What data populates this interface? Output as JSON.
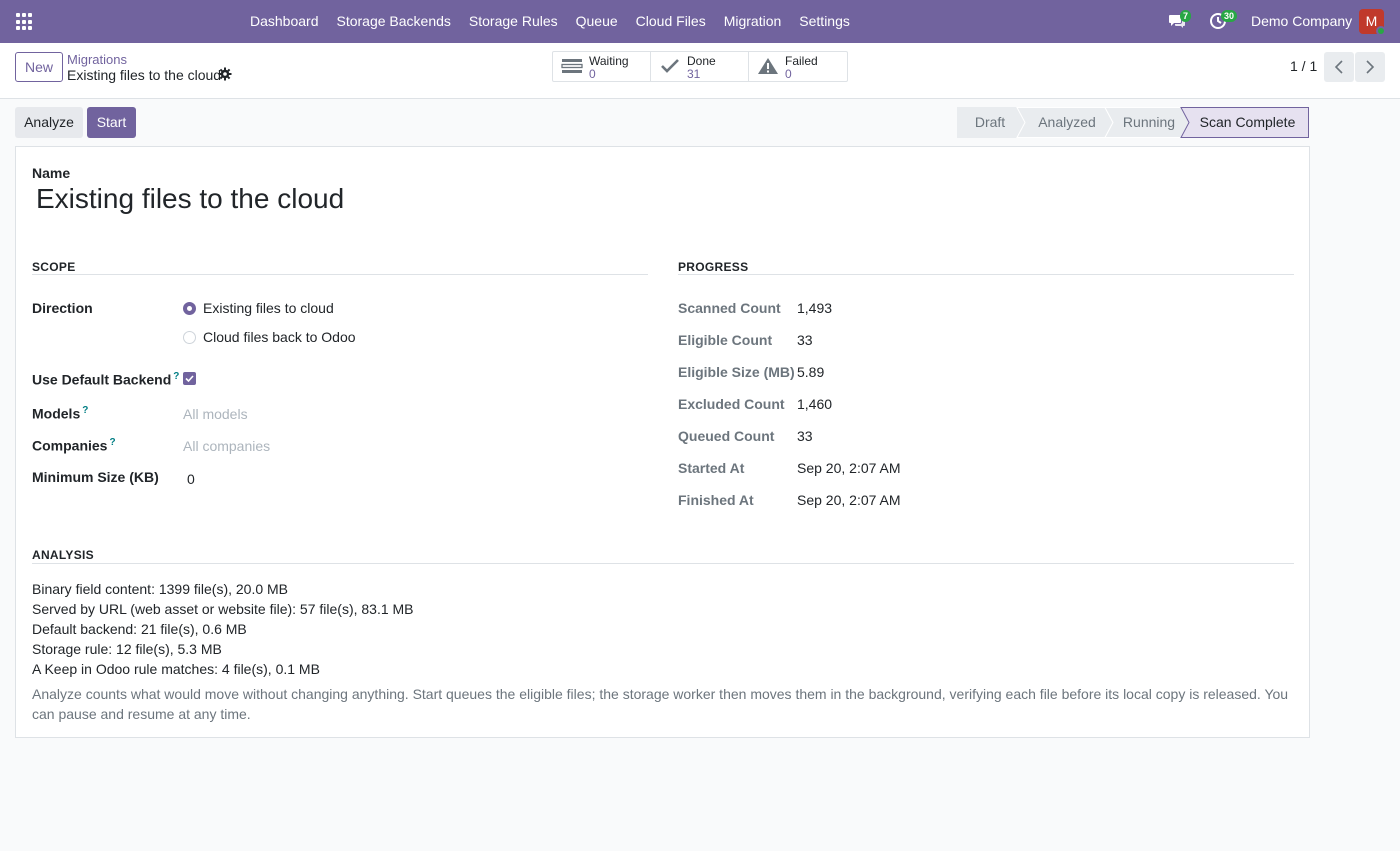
{
  "navbar": {
    "menu": [
      "Dashboard",
      "Storage Backends",
      "Storage Rules",
      "Queue",
      "Cloud Files",
      "Migration",
      "Settings"
    ],
    "messages_count": "7",
    "activities_count": "30",
    "company": "Demo Company",
    "avatar_initial": "M",
    "accent_color": "#71639e"
  },
  "control_panel": {
    "new_label": "New",
    "breadcrumb_parent": "Migrations",
    "breadcrumb_current": "Existing files to the cloud",
    "stats": [
      {
        "label": "Waiting",
        "value": "0",
        "icon": "waiting-list-icon"
      },
      {
        "label": "Done",
        "value": "31",
        "icon": "check-icon"
      },
      {
        "label": "Failed",
        "value": "0",
        "icon": "warning-icon"
      }
    ],
    "pager": "1 / 1"
  },
  "statusbar": {
    "analyze_label": "Analyze",
    "start_label": "Start",
    "stages": [
      "Draft",
      "Analyzed",
      "Running",
      "Scan Complete"
    ],
    "current_stage": "Scan Complete"
  },
  "form": {
    "name_label": "Name",
    "name_value": "Existing files to the cloud",
    "scope": {
      "title": "SCOPE",
      "direction_label": "Direction",
      "direction_options": [
        "Existing files to cloud",
        "Cloud files back to Odoo"
      ],
      "direction_selected": "Existing files to cloud",
      "use_default_backend_label": "Use Default Backend",
      "use_default_backend": true,
      "models_label": "Models",
      "models_placeholder": "All models",
      "companies_label": "Companies",
      "companies_placeholder": "All companies",
      "min_size_label": "Minimum Size (KB)",
      "min_size_value": "0",
      "help_marker": "?"
    },
    "progress": {
      "title": "PROGRESS",
      "rows": [
        {
          "label": "Scanned Count",
          "value": "1,493"
        },
        {
          "label": "Eligible Count",
          "value": "33"
        },
        {
          "label": "Eligible Size (MB)",
          "value": "5.89"
        },
        {
          "label": "Excluded Count",
          "value": "1,460"
        },
        {
          "label": "Queued Count",
          "value": "33"
        },
        {
          "label": "Started At",
          "value": "Sep 20, 2:07 AM"
        },
        {
          "label": "Finished At",
          "value": "Sep 20, 2:07 AM"
        }
      ]
    },
    "analysis": {
      "title": "ANALYSIS",
      "lines": [
        "Binary field content: 1399 file(s), 20.0 MB",
        "Served by URL (web asset or website file): 57 file(s), 83.1 MB",
        "Default backend: 21 file(s), 0.6 MB",
        "Storage rule: 12 file(s), 5.3 MB",
        "A Keep in Odoo rule matches: 4 file(s), 0.1 MB"
      ],
      "help": "Analyze counts what would move without changing anything. Start queues the eligible files; the storage worker then moves them in the background, verifying each file before its local copy is released. You can pause and resume at any time."
    }
  }
}
